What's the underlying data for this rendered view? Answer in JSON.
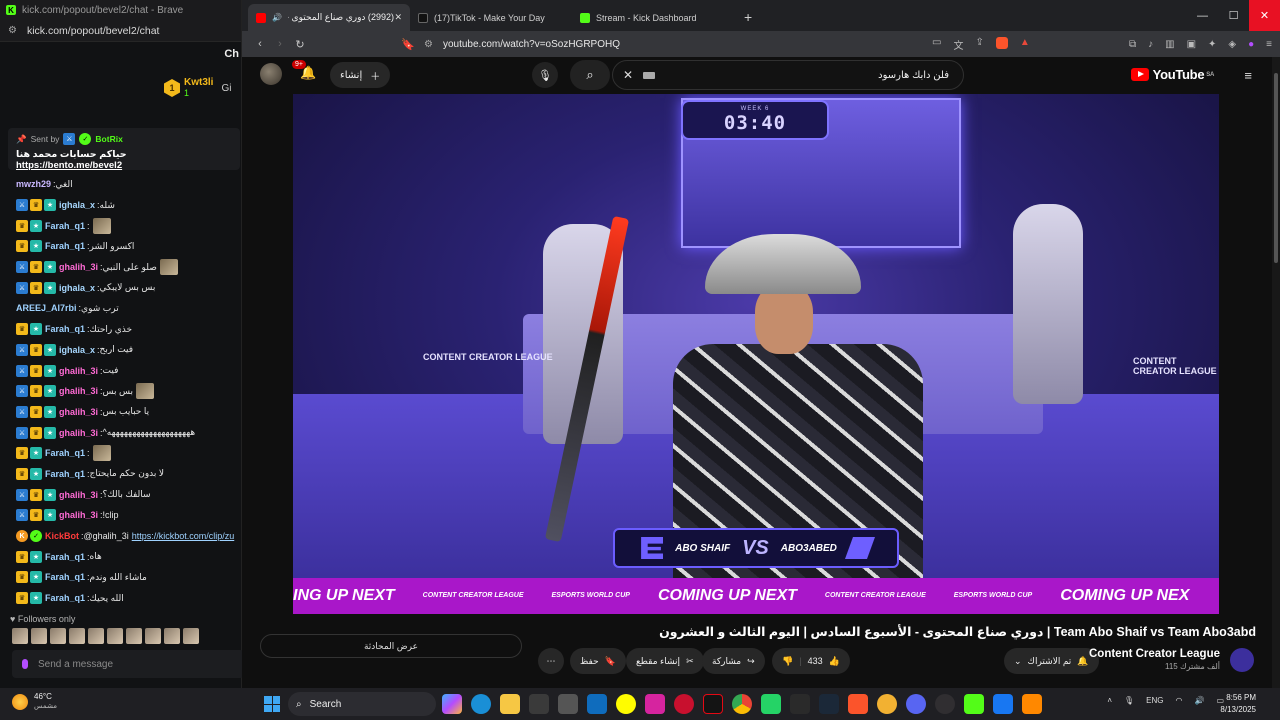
{
  "kick": {
    "window_title": "kick.com/popout/bevel2/chat - Brave",
    "url": "kick.com/popout/bevel2/chat",
    "header_cut": "Ch",
    "top_gifter": {
      "name": "Kwt3li",
      "count": "1",
      "rank": "1",
      "next": "Gi"
    },
    "pinned": {
      "sent_by_label": "Sent by",
      "sender": "BotRix",
      "text_prefix": "حياكم حسابات محمد هنا",
      "link": "https://bento.me/bevel2"
    },
    "messages": [
      {
        "user": "mwzh29",
        "color": "#c9b8ff",
        "text": "الغي",
        "badges": []
      },
      {
        "user": "ighala_x",
        "color": "#a8d8ff",
        "text": "شله",
        "badges": [
          "mod",
          "vip",
          "sub"
        ]
      },
      {
        "user": "Farah_q1",
        "color": "#9fd2ff",
        "text": "",
        "emote": true,
        "badges": [
          "vip",
          "sub"
        ]
      },
      {
        "user": "Farah_q1",
        "color": "#9fd2ff",
        "text": "اكسرو الشر",
        "badges": [
          "vip",
          "sub"
        ]
      },
      {
        "user": "ghalih_3i",
        "color": "#ff6bd5",
        "text": "صلو على النبي",
        "emote": true,
        "badges": [
          "mod",
          "vip",
          "sub"
        ]
      },
      {
        "user": "ighala_x",
        "color": "#a8d8ff",
        "text": "بس بس لايبكي",
        "badges": [
          "mod",
          "vip",
          "sub"
        ]
      },
      {
        "user": "AREEJ_Al7rbi",
        "color": "#9fd2ff",
        "text": "ترب شوي",
        "badges": []
      },
      {
        "user": "Farah_q1",
        "color": "#9fd2ff",
        "text": "خذي راحتك",
        "badges": [
          "vip",
          "sub"
        ]
      },
      {
        "user": "ighala_x",
        "color": "#a8d8ff",
        "text": "فيت اربح",
        "badges": [
          "mod",
          "vip",
          "sub"
        ]
      },
      {
        "user": "ghalih_3i",
        "color": "#ff6bd5",
        "text": "فيت",
        "badges": [
          "mod",
          "vip",
          "sub"
        ]
      },
      {
        "user": "ghalih_3i",
        "color": "#ff6bd5",
        "text": "بس بس",
        "emote": true,
        "badges": [
          "mod",
          "vip",
          "sub"
        ]
      },
      {
        "user": "ghalih_3i",
        "color": "#ff6bd5",
        "text": "يا حبايب بس",
        "badges": [
          "mod",
          "vip",
          "sub"
        ]
      },
      {
        "user": "ghalih_3i",
        "color": "#ff6bd5",
        "text": "^ههههههههههههههههههههه",
        "badges": [
          "mod",
          "vip",
          "sub"
        ]
      },
      {
        "user": "Farah_q1",
        "color": "#9fd2ff",
        "text": "",
        "emote": true,
        "badges": [
          "vip",
          "sub"
        ]
      },
      {
        "user": "Farah_q1",
        "color": "#9fd2ff",
        "text": "لا بدون حكم مايحتاج",
        "badges": [
          "vip",
          "sub"
        ]
      },
      {
        "user": "ghalih_3i",
        "color": "#ff6bd5",
        "text": "سالفك بالك؟",
        "badges": [
          "mod",
          "vip",
          "sub"
        ]
      },
      {
        "user": "ghalih_3i",
        "color": "#ff6bd5",
        "text": "!clip",
        "badges": [
          "mod",
          "vip",
          "sub"
        ]
      },
      {
        "user": "KickBot",
        "color": "#ff3b3b",
        "text": "@ghalih_3i",
        "link": "https://kickbot.com/clip/zu",
        "badges": [
          "bot",
          "ok"
        ]
      },
      {
        "user": "Farah_q1",
        "color": "#9fd2ff",
        "text": "هاه",
        "badges": [
          "vip",
          "sub"
        ]
      },
      {
        "user": "Farah_q1",
        "color": "#9fd2ff",
        "text": "ماشاء الله وندم",
        "badges": [
          "vip",
          "sub"
        ]
      },
      {
        "user": "Farah_q1",
        "color": "#9fd2ff",
        "text": "الله يحيك",
        "badges": [
          "vip",
          "sub"
        ]
      }
    ],
    "followers_only": "Followers only",
    "send_placeholder": "Send a message"
  },
  "browser": {
    "tabs": [
      {
        "label": "(2992) دوري صناع المحتوى - ال",
        "favicon_color": "#ff0000",
        "active": true
      },
      {
        "label": "(17)TikTok - Make Your Day",
        "favicon_color": "#111111",
        "active": false
      },
      {
        "label": "Stream - Kick Dashboard",
        "favicon_color": "#53fc18",
        "active": false
      }
    ],
    "url": "youtube.com/watch?v=oSozHGRPOHQ"
  },
  "youtube": {
    "logo": "YouTube",
    "region": "SA",
    "search_value": "فلن دابك هارسود",
    "create_label": "إنشاء",
    "notif_count": "9+",
    "video": {
      "week_label": "WEEK 6",
      "timer": "03:40",
      "team_left": "ABO SHAIF",
      "vs": "VS",
      "team_right": "ABO3ABED",
      "ticker_text": "COMING UP NEXT",
      "ticker_tail": "ING UP NEXT",
      "ticker_end": "COMING UP NEX",
      "ticker_logo_a": "CONTENT CREATOR LEAGUE",
      "ticker_logo_b": "ESPORTS WORLD CUP",
      "stage_logo": "CONTENT CREATOR LEAGUE"
    },
    "title": "دوري صناع المحتوى - الأسبوع السادس | اليوم الثالث و العشرون | Team Abo Shaif vs Team Abo3abd",
    "channel": {
      "name": "Content Creator League",
      "subs": "115 ألف مشترك",
      "subscribed_label": "تم الاشتراك"
    },
    "likes": "433",
    "share_label": "مشاركة",
    "clip_label": "إنشاء مقطع",
    "save_label": "حفظ",
    "show_chat_label": "عرض المحادثة"
  },
  "taskbar": {
    "temp": "46°C",
    "condition": "مشمس",
    "search_label": "Search",
    "lang": "ENG",
    "time": "8:56 PM",
    "date": "8/13/2025"
  }
}
